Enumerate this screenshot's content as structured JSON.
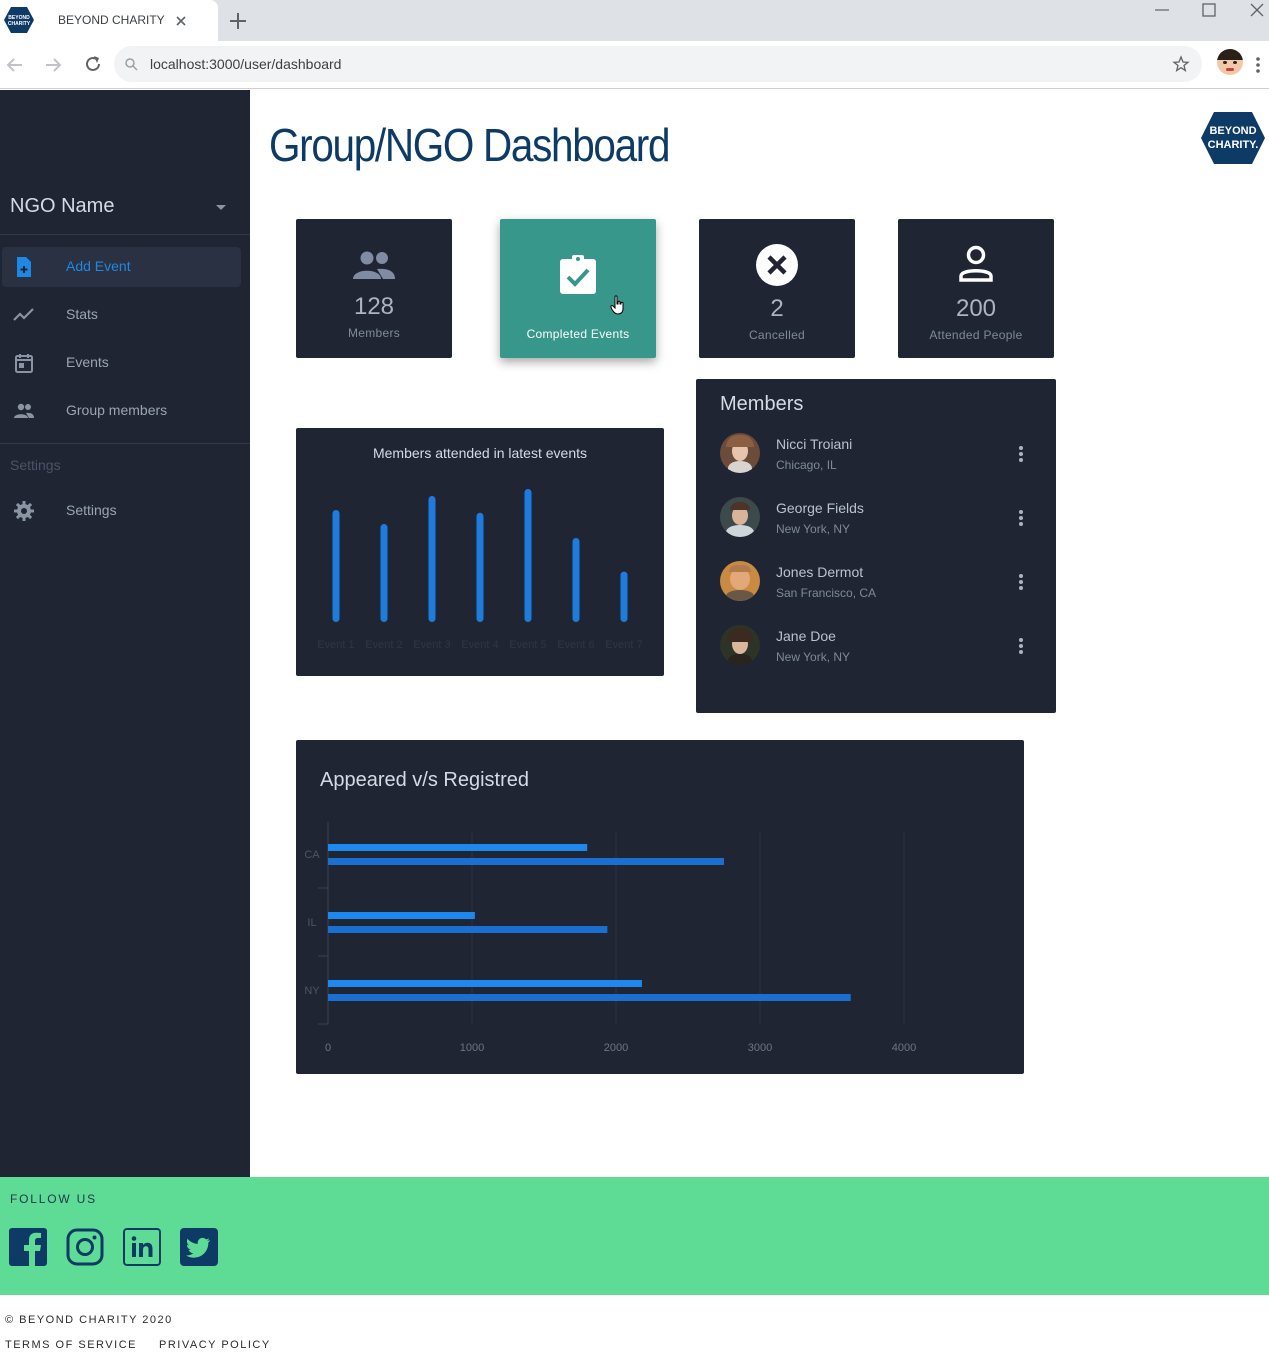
{
  "browser": {
    "tab_title": "BEYOND CHARITY",
    "tab_logo_text": "BEYOND CHARITY",
    "url": "localhost:3000/user/dashboard"
  },
  "sidebar": {
    "org_name": "NGO Name",
    "items": [
      {
        "label": "Add Event",
        "icon": "file-plus-icon",
        "active": true
      },
      {
        "label": "Stats",
        "icon": "trend-line-icon",
        "active": false
      },
      {
        "label": "Events",
        "icon": "calendar-icon",
        "active": false
      },
      {
        "label": "Group members",
        "icon": "people-icon",
        "active": false
      }
    ],
    "section_label": "Settings",
    "settings_item": {
      "label": "Settings",
      "icon": "gear-icon"
    }
  },
  "header": {
    "title": "Group/NGO Dashboard",
    "logo_line1": "BEYOND",
    "logo_line2": "CHARITY."
  },
  "stats": [
    {
      "value": "128",
      "label": "Members",
      "icon": "people-icon"
    },
    {
      "value": "",
      "label": "Completed Events",
      "icon": "clipboard-check-icon"
    },
    {
      "value": "2",
      "label": "Cancelled",
      "icon": "cancel-circle-icon"
    },
    {
      "value": "200",
      "label": "Attended People",
      "icon": "person-icon"
    }
  ],
  "members_panel": {
    "title": "Members",
    "members": [
      {
        "name": "Nicci Troiani",
        "location": "Chicago, IL"
      },
      {
        "name": "George Fields",
        "location": "New York, NY"
      },
      {
        "name": "Jones Dermot",
        "location": "San Francisco, CA"
      },
      {
        "name": "Jane Doe",
        "location": "New York, NY"
      }
    ]
  },
  "colors": {
    "sidebar_bg": "#1f2533",
    "accent_blue": "#1e88e5",
    "accent_teal": "#37978a",
    "footer_green": "#5edb94",
    "title_navy": "#0d3b66"
  },
  "chart_data": [
    {
      "type": "bar",
      "title": "Members attended in latest events",
      "categories": [
        "Event 1",
        "Event 2",
        "Event 3",
        "Event 4",
        "Event 5",
        "Event 6",
        "Event 7"
      ],
      "values": [
        80,
        70,
        90,
        78,
        95,
        60,
        36
      ],
      "ylim": [
        0,
        100
      ]
    },
    {
      "type": "bar",
      "orientation": "horizontal",
      "title": "Appeared v/s Registred",
      "categories": [
        "CA",
        "IL",
        "NY"
      ],
      "series": [
        {
          "values": [
            1800,
            1020,
            2180
          ]
        },
        {
          "values": [
            2750,
            1940,
            3630
          ]
        }
      ],
      "xticks": [
        "0",
        "1000",
        "2000",
        "3000",
        "4000"
      ],
      "xlim": [
        0,
        4000
      ]
    }
  ],
  "footer": {
    "follow_label": "FOLLOW US",
    "socials": [
      "facebook-icon",
      "instagram-icon",
      "linkedin-icon",
      "twitter-icon"
    ],
    "copyright": "© BEYOND CHARITY 2020",
    "terms": "TERMS OF SERVICE",
    "privacy": "PRIVACY POLICY"
  }
}
